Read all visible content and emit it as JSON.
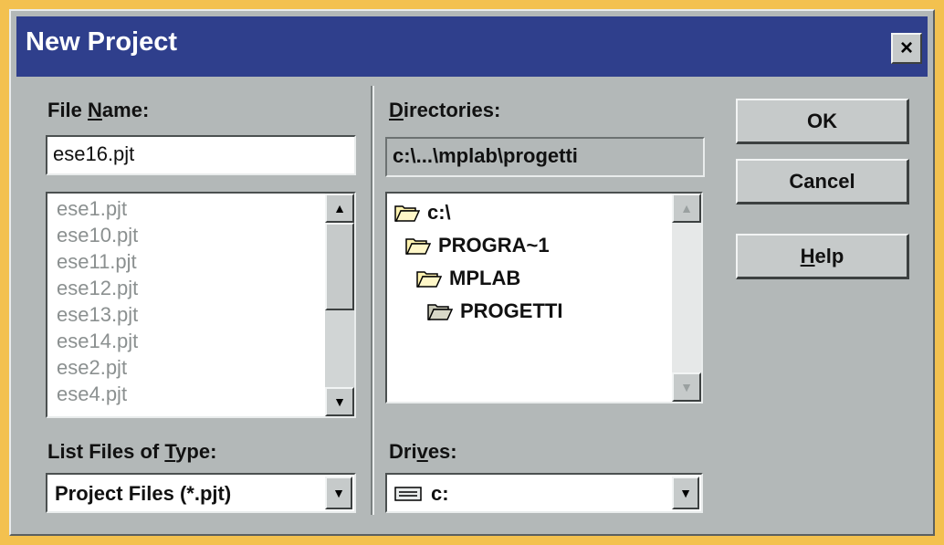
{
  "window": {
    "title": "New Project",
    "close_glyph": "×"
  },
  "file_name": {
    "label_pre": "File ",
    "label_key": "N",
    "label_post": "ame:",
    "value": "ese16.pjt",
    "files": [
      "ese1.pjt",
      "ese10.pjt",
      "ese11.pjt",
      "ese12.pjt",
      "ese13.pjt",
      "ese14.pjt",
      "ese2.pjt",
      "ese4.pjt"
    ]
  },
  "directories": {
    "label_pre": "",
    "label_key": "D",
    "label_post": "irectories:",
    "path": "c:\\...\\mplab\\progetti",
    "items": [
      "c:\\",
      "PROGRA~1",
      "MPLAB",
      "PROGETTI"
    ]
  },
  "file_type": {
    "label_pre": "List Files of ",
    "label_key": "T",
    "label_post": "ype:",
    "value": "Project Files (*.pjt)"
  },
  "drives": {
    "label_pre": "Dri",
    "label_key": "v",
    "label_post": "es:",
    "value": "c:"
  },
  "buttons": {
    "ok": "OK",
    "cancel": "Cancel",
    "help_key": "H",
    "help_post": "elp"
  },
  "icons": {
    "folder_open": "folder-open-icon",
    "drive": "drive-icon",
    "arrow_up": "▲",
    "arrow_down": "▼"
  }
}
